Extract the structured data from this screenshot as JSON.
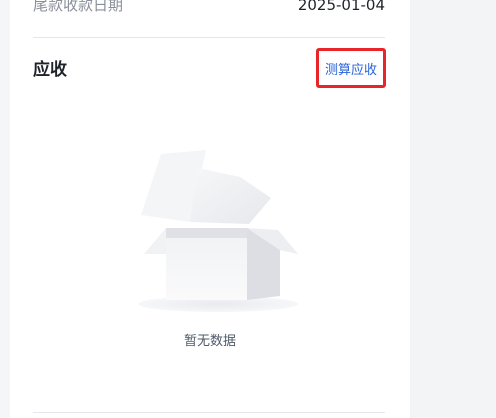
{
  "top_row": {
    "label": "尾款收款日期",
    "value": "2025-01-04"
  },
  "receivable_section": {
    "title": "应收",
    "action_label": "测算应收",
    "empty_text": "暂无数据"
  },
  "colors": {
    "accent_link": "#2a63d9",
    "highlight_border": "#e8262a"
  }
}
